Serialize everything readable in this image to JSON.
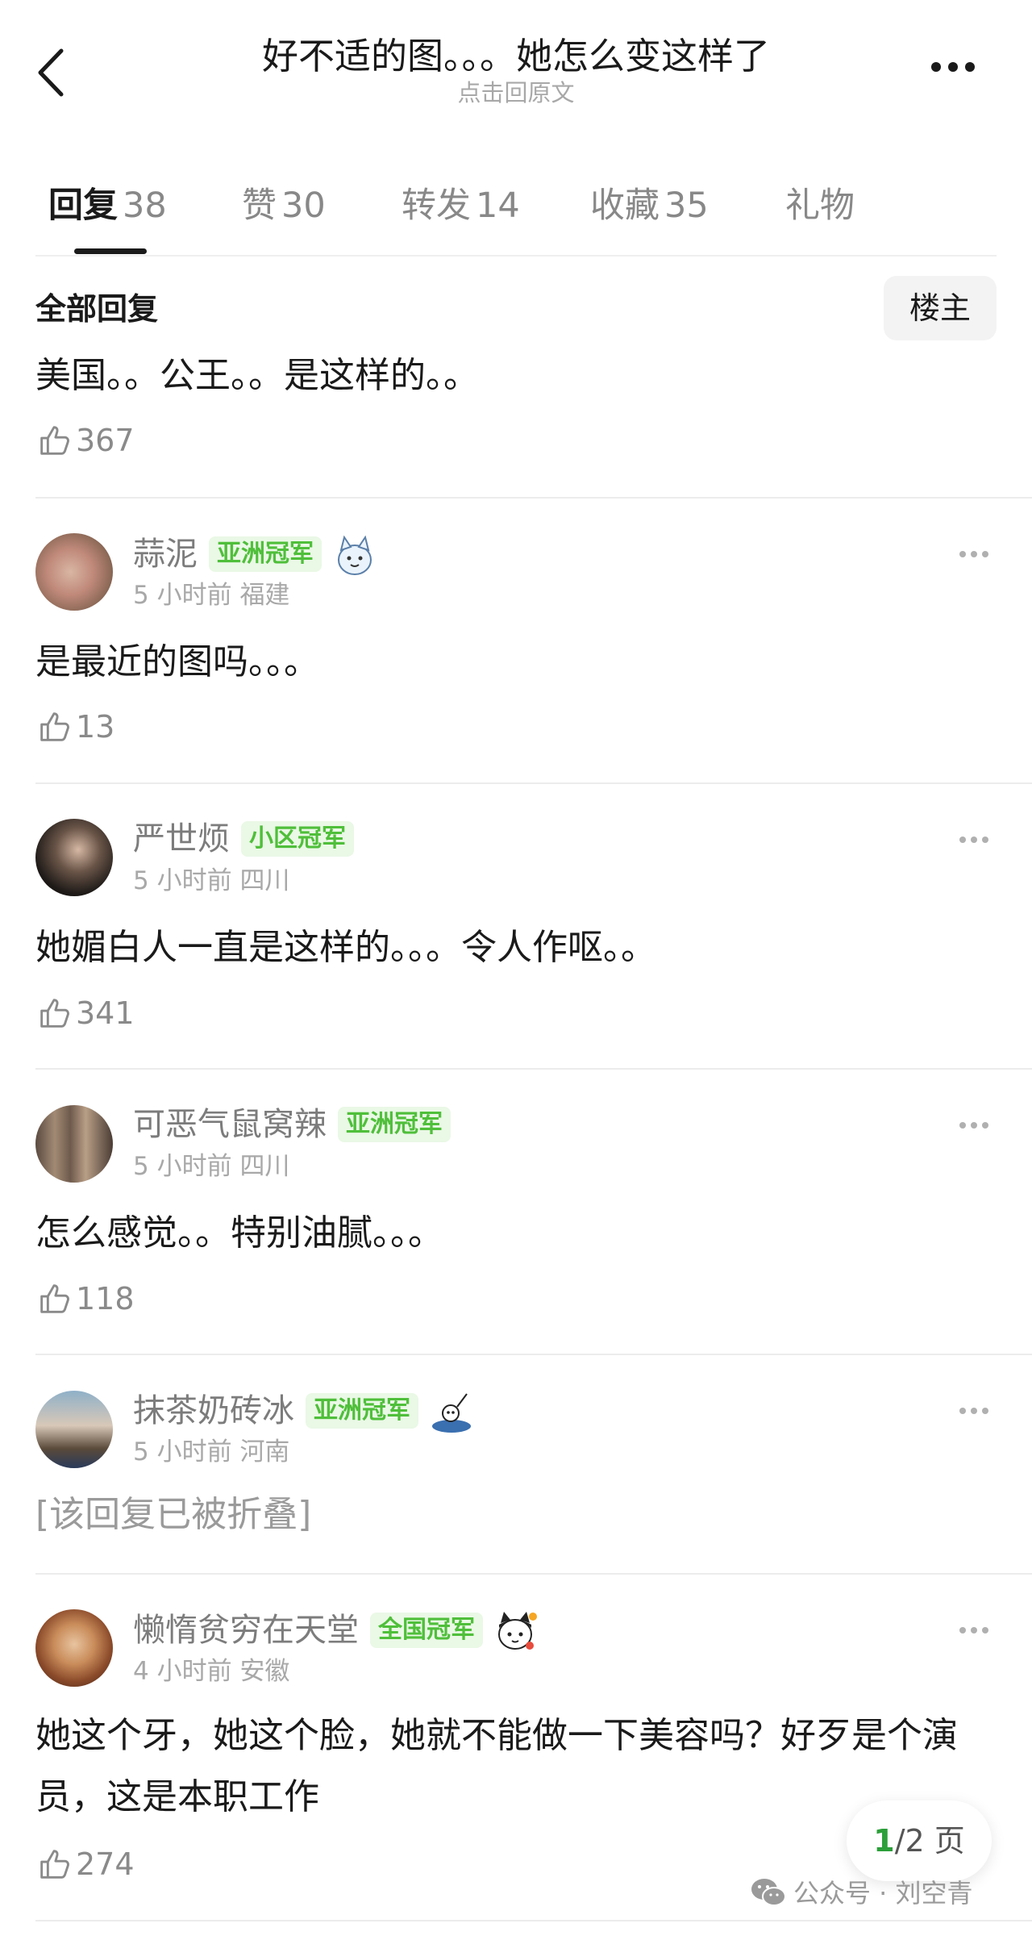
{
  "header": {
    "title": "好不适的图。。。她怎么变这样了",
    "subtitle": "点击回原文"
  },
  "tabs": [
    {
      "label": "回复",
      "count": "38"
    },
    {
      "label": "赞",
      "count": "30"
    },
    {
      "label": "转发",
      "count": "14"
    },
    {
      "label": "收藏",
      "count": "35"
    },
    {
      "label": "礼物",
      "count": ""
    }
  ],
  "section": {
    "title": "全部回复",
    "op_button": "楼主"
  },
  "op_comment": {
    "text": "美国。。公王。。是这样的。。",
    "likes": "367"
  },
  "comments": [
    {
      "name": "蒜泥",
      "badge": "亚洲冠军",
      "time": "5 小时前",
      "location": "福建",
      "text": "是最近的图吗。。。",
      "likes": "13",
      "folded": false
    },
    {
      "name": "严世烦",
      "badge": "小区冠军",
      "time": "5 小时前",
      "location": "四川",
      "text": "她媚白人一直是这样的。。。令人作呕。。",
      "likes": "341",
      "folded": false
    },
    {
      "name": "可恶气鼠窝辣",
      "badge": "亚洲冠军",
      "time": "5 小时前",
      "location": "四川",
      "text": "怎么感觉。。特别油腻。。。",
      "likes": "118",
      "folded": false
    },
    {
      "name": "抹茶奶砖冰",
      "badge": "亚洲冠军",
      "time": "5 小时前",
      "location": "河南",
      "text": "[该回复已被折叠]",
      "likes": "",
      "folded": true
    },
    {
      "name": "懒惰贫穷在天堂",
      "badge": "全国冠军",
      "time": "4 小时前",
      "location": "安徽",
      "text": "她这个牙，她这个脸，她就不能做一下美容吗？好歹是个演员，这是本职工作",
      "likes": "274",
      "folded": false
    }
  ],
  "pager": {
    "current": "1",
    "total_label": "/2 页"
  },
  "watermark": {
    "text": "公众号 · 刘空青"
  },
  "colors": {
    "badge_text": "#4fbf3a",
    "badge_bg": "#eaf8e6",
    "pager_current": "#2c9f3a"
  },
  "icons": {
    "back": "chevron-left-icon",
    "more": "ellipsis-icon",
    "like": "thumbs-up-icon",
    "watermark": "wechat-icon"
  }
}
